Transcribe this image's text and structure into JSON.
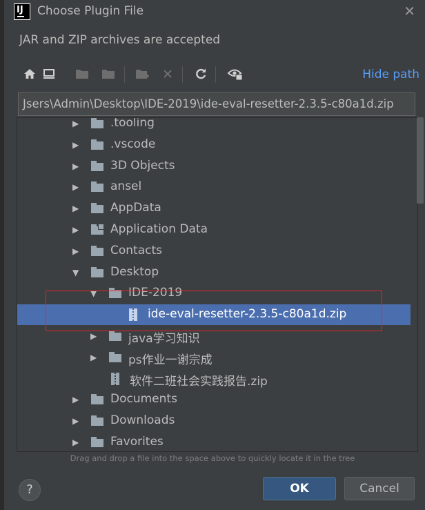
{
  "window": {
    "title": "Choose Plugin File"
  },
  "subtitle": "JAR and ZIP archives are accepted",
  "toolbar": {
    "buttons": [
      "home-icon",
      "desktop-icon",
      "project-folder-icon",
      "module-folder-icon",
      "new-folder-icon",
      "delete-icon",
      "refresh-icon",
      "show-hidden-icon"
    ],
    "hide_path_label": "Hide path"
  },
  "path": {
    "value": "Jsers\\Admin\\Desktop\\IDE-2019\\ide-eval-resetter-2.3.5-c80a1d.zip"
  },
  "tree": {
    "items": [
      {
        "label": ".tooling",
        "level": 0,
        "type": "folder",
        "state": "collapsed"
      },
      {
        "label": ".vscode",
        "level": 0,
        "type": "folder",
        "state": "collapsed"
      },
      {
        "label": "3D Objects",
        "level": 0,
        "type": "folder",
        "state": "collapsed"
      },
      {
        "label": "ansel",
        "level": 0,
        "type": "folder",
        "state": "collapsed"
      },
      {
        "label": "AppData",
        "level": 0,
        "type": "folder",
        "state": "collapsed"
      },
      {
        "label": "Application Data",
        "level": 0,
        "type": "folder-link",
        "state": "collapsed"
      },
      {
        "label": "Contacts",
        "level": 0,
        "type": "folder",
        "state": "collapsed"
      },
      {
        "label": "Desktop",
        "level": 0,
        "type": "folder",
        "state": "expanded"
      },
      {
        "label": "IDE-2019",
        "level": 1,
        "type": "folder",
        "state": "expanded"
      },
      {
        "label": "ide-eval-resetter-2.3.5-c80a1d.zip",
        "level": 2,
        "type": "zip",
        "selected": true
      },
      {
        "label": "java学习知识",
        "level": 1,
        "type": "folder",
        "state": "collapsed"
      },
      {
        "label": "ps作业一谢宗成",
        "level": 1,
        "type": "folder",
        "state": "collapsed"
      },
      {
        "label": "软件二班社会实践报告.zip",
        "level": 1,
        "type": "zip"
      },
      {
        "label": "Documents",
        "level": 0,
        "type": "folder",
        "state": "collapsed"
      },
      {
        "label": "Downloads",
        "level": 0,
        "type": "folder",
        "state": "collapsed"
      },
      {
        "label": "Favorites",
        "level": 0,
        "type": "folder",
        "state": "collapsed"
      }
    ]
  },
  "hint": "Drag and drop a file into the space above to quickly locate it in the tree",
  "buttons": {
    "help": "?",
    "ok": "OK",
    "cancel": "Cancel"
  },
  "colors": {
    "background": "#3c3f41",
    "selection": "#4b6eaf",
    "link": "#589df6",
    "annotation": "#e0262b"
  }
}
